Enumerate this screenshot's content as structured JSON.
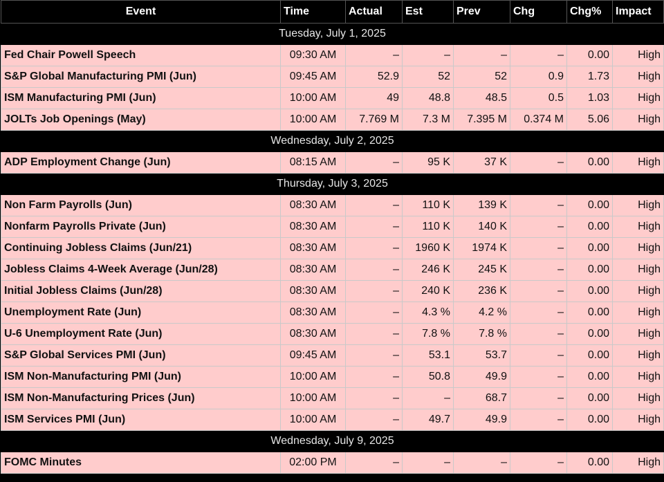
{
  "headers": [
    "Event",
    "Time",
    "Actual",
    "Est",
    "Prev",
    "Chg",
    "Chg%",
    "Impact"
  ],
  "groups": [
    {
      "date": "Tuesday, July 1, 2025",
      "rows": [
        [
          "Fed Chair Powell Speech",
          "09:30 AM",
          "–",
          "–",
          "–",
          "–",
          "0.00",
          "High"
        ],
        [
          "S&P Global Manufacturing PMI (Jun)",
          "09:45 AM",
          "52.9",
          "52",
          "52",
          "0.9",
          "1.73",
          "High"
        ],
        [
          "ISM Manufacturing PMI (Jun)",
          "10:00 AM",
          "49",
          "48.8",
          "48.5",
          "0.5",
          "1.03",
          "High"
        ],
        [
          "JOLTs Job Openings (May)",
          "10:00 AM",
          "7.769 M",
          "7.3 M",
          "7.395 M",
          "0.374 M",
          "5.06",
          "High"
        ]
      ]
    },
    {
      "date": "Wednesday, July 2, 2025",
      "rows": [
        [
          "ADP Employment Change (Jun)",
          "08:15 AM",
          "–",
          "95 K",
          "37 K",
          "–",
          "0.00",
          "High"
        ]
      ]
    },
    {
      "date": "Thursday, July 3, 2025",
      "rows": [
        [
          "Non Farm Payrolls (Jun)",
          "08:30 AM",
          "–",
          "110 K",
          "139 K",
          "–",
          "0.00",
          "High"
        ],
        [
          "Nonfarm Payrolls Private (Jun)",
          "08:30 AM",
          "–",
          "110 K",
          "140 K",
          "–",
          "0.00",
          "High"
        ],
        [
          "Continuing Jobless Claims (Jun/21)",
          "08:30 AM",
          "–",
          "1960 K",
          "1974 K",
          "–",
          "0.00",
          "High"
        ],
        [
          "Jobless Claims 4-Week Average (Jun/28)",
          "08:30 AM",
          "–",
          "246 K",
          "245 K",
          "–",
          "0.00",
          "High"
        ],
        [
          "Initial Jobless Claims (Jun/28)",
          "08:30 AM",
          "–",
          "240 K",
          "236 K",
          "–",
          "0.00",
          "High"
        ],
        [
          "Unemployment Rate (Jun)",
          "08:30 AM",
          "–",
          "4.3 %",
          "4.2 %",
          "–",
          "0.00",
          "High"
        ],
        [
          "U-6 Unemployment Rate (Jun)",
          "08:30 AM",
          "–",
          "7.8 %",
          "7.8 %",
          "–",
          "0.00",
          "High"
        ],
        [
          "S&P Global Services PMI (Jun)",
          "09:45 AM",
          "–",
          "53.1",
          "53.7",
          "–",
          "0.00",
          "High"
        ],
        [
          "ISM Non-Manufacturing PMI (Jun)",
          "10:00 AM",
          "–",
          "50.8",
          "49.9",
          "–",
          "0.00",
          "High"
        ],
        [
          "ISM Non-Manufacturing Prices (Jun)",
          "10:00 AM",
          "–",
          "–",
          "68.7",
          "–",
          "0.00",
          "High"
        ],
        [
          "ISM Services PMI (Jun)",
          "10:00 AM",
          "–",
          "49.7",
          "49.9",
          "–",
          "0.00",
          "High"
        ]
      ]
    },
    {
      "date": "Wednesday, July 9, 2025",
      "rows": [
        [
          "FOMC Minutes",
          "02:00 PM",
          "–",
          "–",
          "–",
          "–",
          "0.00",
          "High"
        ]
      ]
    }
  ]
}
